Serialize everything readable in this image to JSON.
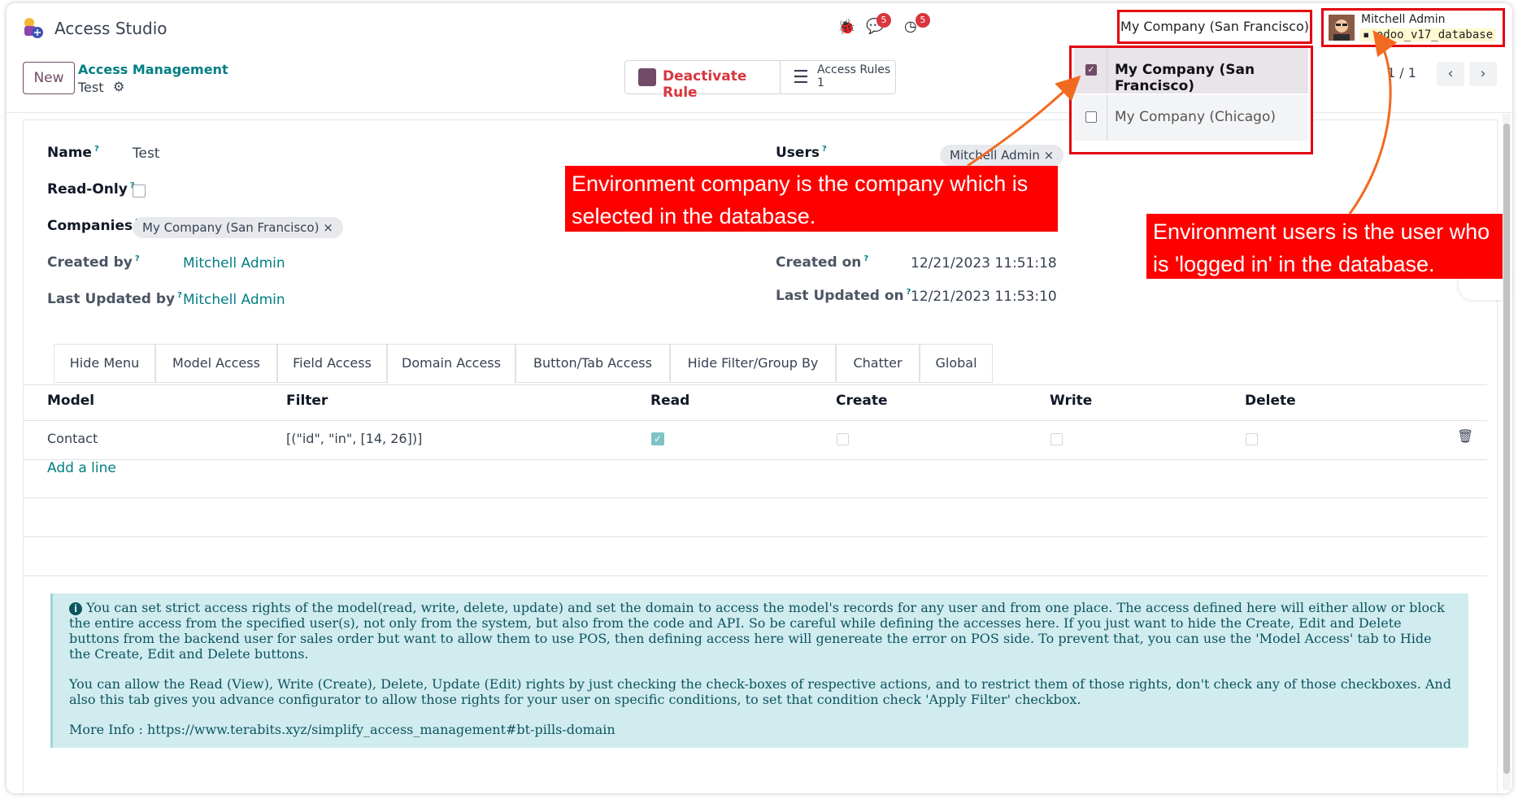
{
  "app": {
    "title": "Access Studio"
  },
  "systray": {
    "chat_badge": "5",
    "activity_badge": "5"
  },
  "company_switcher": {
    "current": "My Company (San Francisco)",
    "options": [
      {
        "label": "My Company (San Francisco)",
        "checked": true
      },
      {
        "label": "My Company (Chicago)",
        "checked": false
      }
    ]
  },
  "user": {
    "name": "Mitchell Admin",
    "database": "odoo_v17_database"
  },
  "control": {
    "new_label": "New",
    "breadcrumb_parent": "Access Management",
    "breadcrumb_current": "Test",
    "deactivate_label": "Deactivate Rule",
    "access_rules_label": "Access Rules",
    "access_rules_count": "1",
    "pager": "1 / 1"
  },
  "form": {
    "name_label": "Name",
    "name_value": "Test",
    "readonly_label": "Read-Only",
    "companies_label": "Companies",
    "companies_tag": "My Company (San Francisco)",
    "created_by_label": "Created by",
    "created_by_value": "Mitchell Admin",
    "last_updated_by_label": "Last Updated by",
    "last_updated_by_value": "Mitchell Admin",
    "users_label": "Users",
    "users_tag": "Mitchell Admin",
    "created_on_label": "Created on",
    "created_on_value": "12/21/2023 11:51:18",
    "last_updated_on_label": "Last Updated on",
    "last_updated_on_value": "12/21/2023 11:53:10",
    "help_mark": "?",
    "tag_remove": "×"
  },
  "tabs": [
    {
      "label": "Hide Menu"
    },
    {
      "label": "Model Access"
    },
    {
      "label": "Field Access"
    },
    {
      "label": "Domain Access",
      "active": true
    },
    {
      "label": "Button/Tab Access"
    },
    {
      "label": "Hide Filter/Group By"
    },
    {
      "label": "Chatter"
    },
    {
      "label": "Global"
    }
  ],
  "table": {
    "headers": {
      "model": "Model",
      "filter": "Filter",
      "read": "Read",
      "create": "Create",
      "write": "Write",
      "delete": "Delete"
    },
    "rows": [
      {
        "model": "Contact",
        "filter": "[(\"id\", \"in\", [14, 26])]",
        "read": true,
        "create": false,
        "write": false,
        "delete": false
      }
    ],
    "add_line": "Add a line"
  },
  "info": {
    "paragraph1": "You can set strict access rights of the model(read, write, delete, update) and set the domain to access the model's records for any user and from one place. The access defined here will either allow or block the entire access from the specified user(s), not only from the system, but also from the code and API. So be careful while defining the accesses here. If you just want to hide the Create, Edit and Delete buttons from the backend user for sales order but want to allow them to use POS, then defining access here will genereate the error on POS side. To prevent that, you can use the 'Model Access' tab to Hide the Create, Edit and Delete buttons.",
    "paragraph2": "You can allow the Read (View), Write (Create), Delete, Update (Edit) rights by just checking the check-boxes of respective actions, and to restrict them of those rights, don't check any of those checkboxes. And also this tab gives you advance configurator to allow those rights for your user on specific conditions, to set that condition check 'Apply Filter' checkbox.",
    "more_info_label": "More Info : ",
    "more_info_link": "https://www.terabits.xyz/simplify_access_management#bt-pills-domain"
  },
  "annotations": {
    "company_note": "Environment company is the company which is selected in the database.",
    "user_note": "Environment users is the user who is 'logged in' in the database.",
    "color": "#ff0000",
    "arrow_color": "#f26a21"
  },
  "colors": {
    "brand": "#714b67",
    "link": "#017e84",
    "danger": "#d9363e"
  }
}
